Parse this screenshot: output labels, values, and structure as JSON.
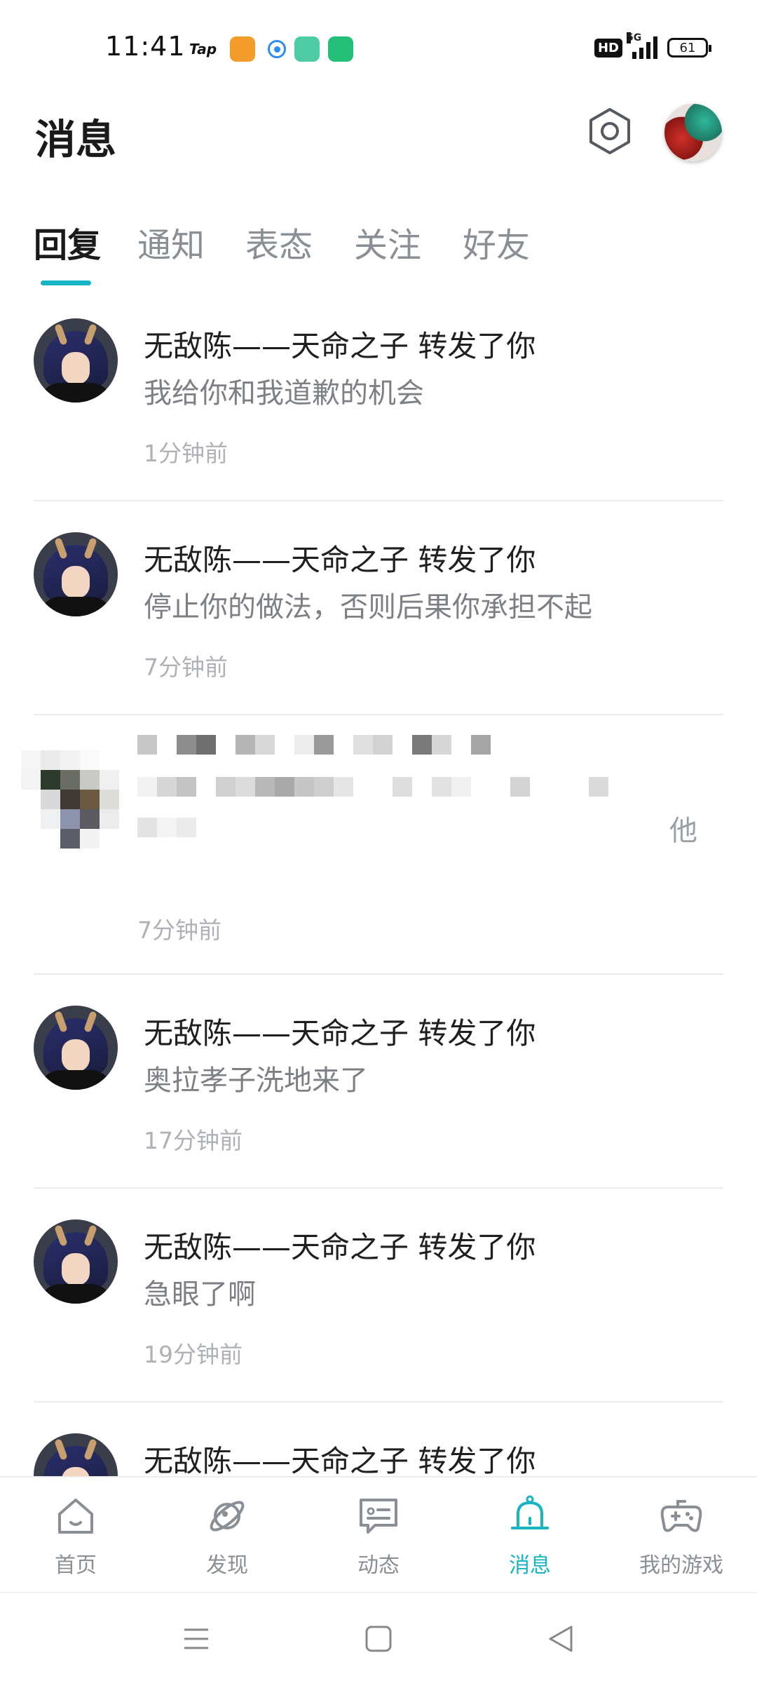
{
  "status_bar": {
    "time": "11:41",
    "app_tap_label": "Tap",
    "hd_badge": "HD",
    "network_label": "5G",
    "battery_level": "61"
  },
  "header": {
    "title": "消息"
  },
  "tabs": [
    {
      "label": "回复",
      "active": true
    },
    {
      "label": "通知",
      "active": false
    },
    {
      "label": "表态",
      "active": false
    },
    {
      "label": "关注",
      "active": false
    },
    {
      "label": "好友",
      "active": false
    }
  ],
  "messages": [
    {
      "title": "无敌陈——天命之子 转发了你",
      "content": "我给你和我道歉的机会",
      "time": "1分钟前"
    },
    {
      "title": "无敌陈——天命之子 转发了你",
      "content": "停止你的做法，否则后果你承担不起",
      "time": "7分钟前"
    },
    {
      "title": "",
      "content_tail": "他",
      "time": "7分钟前",
      "pixelated": true
    },
    {
      "title": "无敌陈——天命之子 转发了你",
      "content": "奥拉孝子洗地来了",
      "time": "17分钟前"
    },
    {
      "title": "无敌陈——天命之子 转发了你",
      "content": "急眼了啊",
      "time": "19分钟前"
    },
    {
      "title": "无敌陈——天命之子 转发了你"
    }
  ],
  "bottom_nav": [
    {
      "label": "首页",
      "icon": "home-icon",
      "active": false
    },
    {
      "label": "发现",
      "icon": "discover-planet-icon",
      "active": false
    },
    {
      "label": "动态",
      "icon": "feed-chat-icon",
      "active": false
    },
    {
      "label": "消息",
      "icon": "bell-icon",
      "active": true
    },
    {
      "label": "我的游戏",
      "icon": "gamepad-icon",
      "active": false
    }
  ],
  "colors": {
    "accent": "#17b4c4",
    "inactive": "#8a8f95"
  }
}
